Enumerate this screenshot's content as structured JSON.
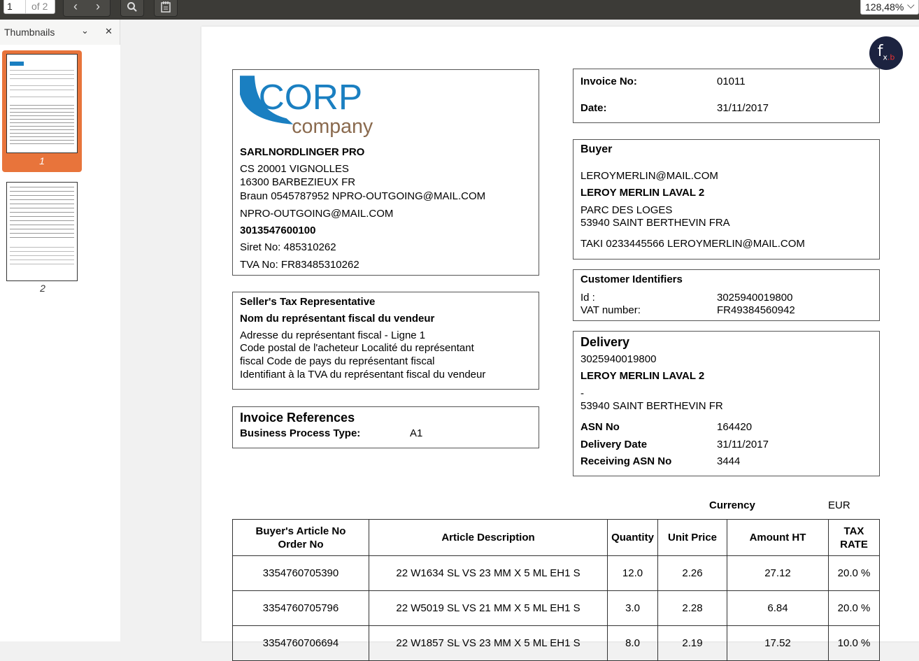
{
  "toolbar": {
    "page_current": "1",
    "page_total": "of 2",
    "zoom": "128,48%"
  },
  "sidebar": {
    "title": "Thumbnails",
    "thumbnails": [
      {
        "label": "1"
      },
      {
        "label": "2"
      }
    ]
  },
  "invoice": {
    "logo": {
      "line1": "CORP",
      "line2": "company"
    },
    "seller": {
      "name": "SARLNORDLINGER PRO",
      "address1": "CS 20001 VIGNOLLES",
      "address2": "16300 BARBEZIEUX FR",
      "contact": "Braun 0545787952 NPRO-OUTGOING@MAIL.COM",
      "email": "NPRO-OUTGOING@MAIL.COM",
      "id": "3013547600100",
      "siret": "Siret No: 485310262",
      "tva": "TVA No: FR83485310262"
    },
    "header": {
      "invoice_no_label": "Invoice No:",
      "invoice_no": "01011",
      "date_label": "Date:",
      "date": "31/11/2017"
    },
    "buyer": {
      "title": "Buyer",
      "email": "LEROYMERLIN@MAIL.COM",
      "name": "LEROY MERLIN LAVAL 2",
      "address1": "PARC DES LOGES",
      "address2": "53940 SAINT BERTHEVIN FRA",
      "contact": "TAKI 0233445566 LEROYMERLIN@MAIL.COM"
    },
    "tax_rep": {
      "title": "Seller's Tax Representative",
      "name": "Nom du représentant fiscal du vendeur",
      "line1": "Adresse du représentant fiscal - Ligne 1",
      "line2": "Code postal de l'acheteur Localité du représentant",
      "line3": "fiscal Code de pays du représentant fiscal",
      "line4": "Identifiant à la TVA du représentant fiscal du vendeur"
    },
    "customer_ids": {
      "title": "Customer Identifiers",
      "id_label": "Id :",
      "id": "3025940019800",
      "vat_label": "VAT number:",
      "vat": "FR49384560942"
    },
    "references": {
      "title": "Invoice References",
      "bpt_label": "Business Process Type:",
      "bpt": "A1"
    },
    "delivery": {
      "title": "Delivery",
      "id": "3025940019800",
      "name": "LEROY MERLIN LAVAL 2",
      "dash": "-",
      "address": "53940 SAINT BERTHEVIN FR",
      "asn_label": "ASN No",
      "asn": "164420",
      "date_label": "Delivery Date",
      "date": "31/11/2017",
      "rasn_label": "Receiving ASN No",
      "rasn": "3444"
    },
    "currency_label": "Currency",
    "currency": "EUR",
    "table": {
      "headers": {
        "article_no_1": "Buyer's Article No",
        "article_no_2": "Order No",
        "description": "Article Description",
        "quantity": "Quantity",
        "unit_price": "Unit Price",
        "amount": "Amount HT",
        "tax_1": "TAX",
        "tax_2": "RATE"
      },
      "rows": [
        {
          "article": "3354760705390",
          "description": "22 W1634 SL VS 23 MM X 5 ML EH1 S",
          "quantity": "12.0",
          "unit_price": "2.26",
          "amount": "27.12",
          "tax": "20.0 %"
        },
        {
          "article": "3354760705796",
          "description": "22 W5019 SL VS 21 MM X 5 ML EH1 S",
          "quantity": "3.0",
          "unit_price": "2.28",
          "amount": "6.84",
          "tax": "20.0 %"
        },
        {
          "article": "3354760706694",
          "description": "22 W1857 SL VS 23 MM X 5 ML EH1 S",
          "quantity": "8.0",
          "unit_price": "2.19",
          "amount": "17.52",
          "tax": "10.0 %"
        }
      ]
    }
  }
}
